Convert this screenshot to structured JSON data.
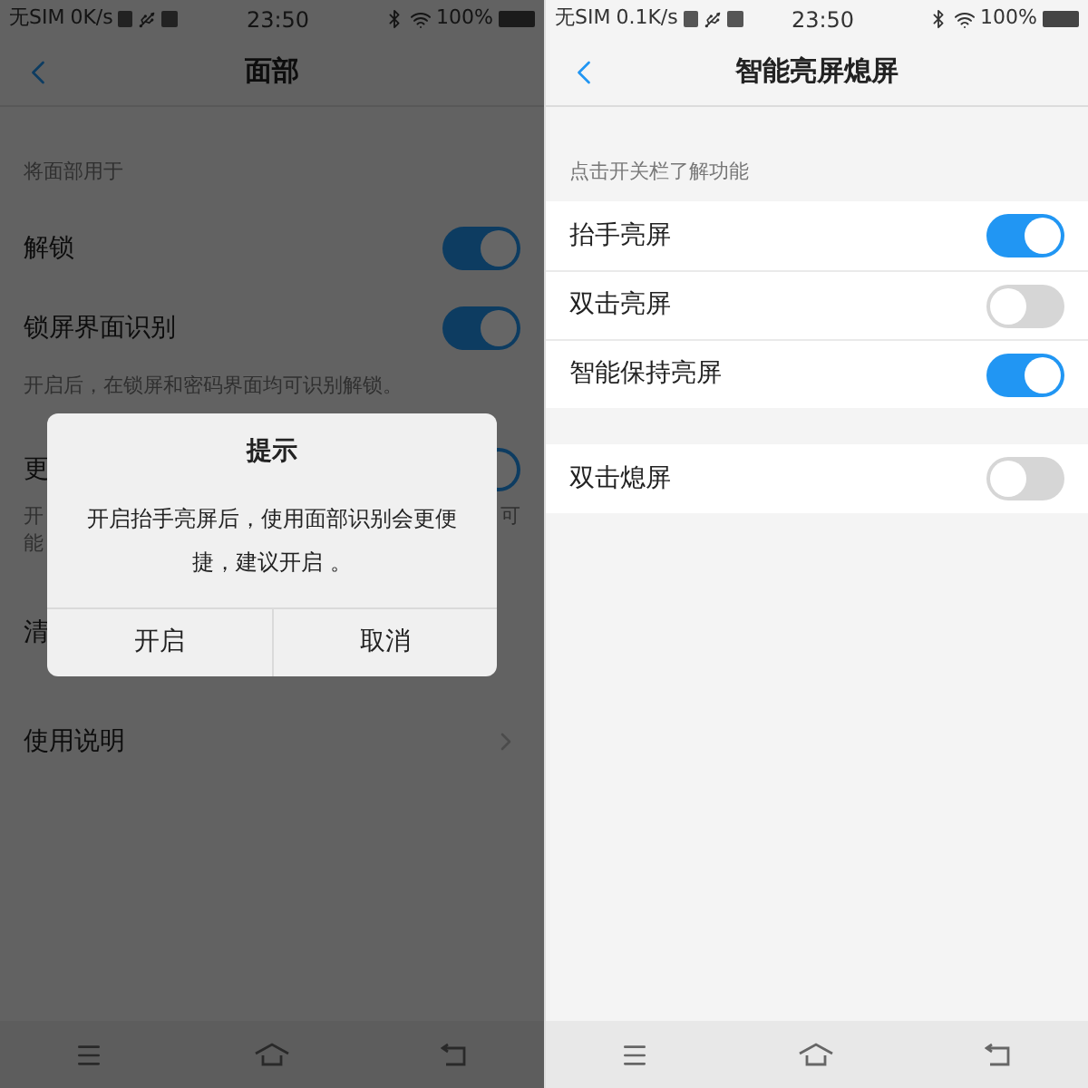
{
  "left_screen": {
    "status_bar": {
      "carrier": "无SIM",
      "speed": "0K/s",
      "time": "23:50",
      "battery": "100%"
    },
    "title": "面部",
    "items": [
      {
        "kind": "section",
        "text": "将面部用于"
      },
      {
        "kind": "toggle",
        "label": "解锁",
        "on": true
      },
      {
        "kind": "toggle",
        "label": "锁屏界面识别",
        "on": true
      },
      {
        "kind": "note",
        "text": "开启后，在锁屏和密码界面均可识别解锁。"
      },
      {
        "kind": "toggle",
        "label": "更",
        "on": true
      },
      {
        "kind": "note_cut",
        "lines": [
          "开",
          "能"
        ],
        "end": "可"
      },
      {
        "kind": "plain",
        "label": "清"
      },
      {
        "kind": "link",
        "label": "使用说明"
      }
    ],
    "dialog": {
      "title": "提示",
      "message": "开启抬手亮屏后，使用面部识别会更便捷，建议开启 。",
      "buttons": [
        "开启",
        "取消"
      ]
    }
  },
  "right_screen": {
    "status_bar": {
      "carrier": "无SIM",
      "speed": "0.1K/s",
      "time": "23:50",
      "battery": "100%"
    },
    "title": "智能亮屏熄屏",
    "section": "点击开关栏了解功能",
    "groups": [
      [
        {
          "label": "抬手亮屏",
          "on": true
        },
        {
          "label": "双击亮屏",
          "on": false
        },
        {
          "label": "智能保持亮屏",
          "on": true
        }
      ],
      [
        {
          "label": "双击熄屏",
          "on": false
        }
      ]
    ]
  }
}
